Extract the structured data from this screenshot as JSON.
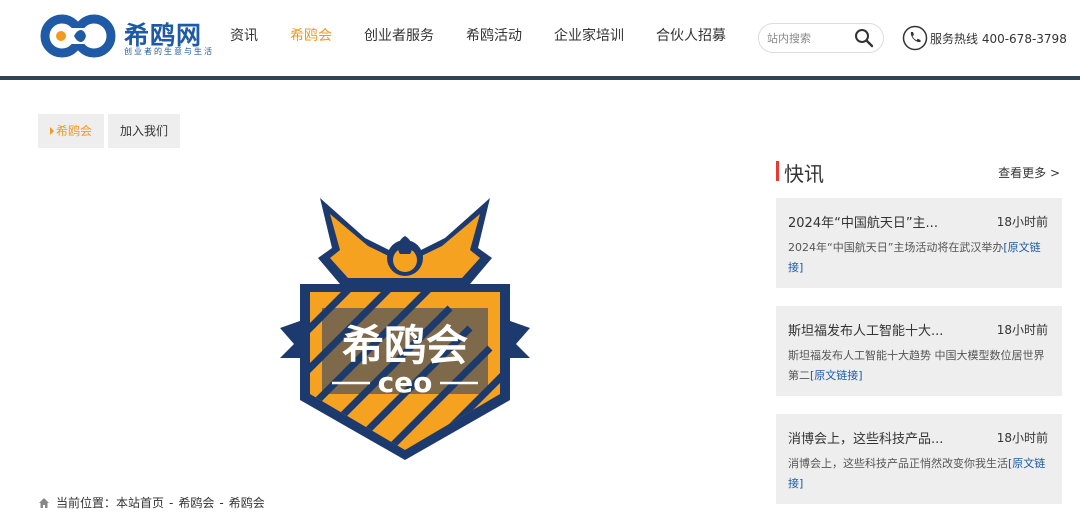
{
  "brand": {
    "name": "希鸥网",
    "tagline": "创业者的生意与生活",
    "color_primary": "#1f5aa6",
    "color_accent": "#f39a1e"
  },
  "nav": {
    "items": [
      {
        "label": "资讯",
        "active": false
      },
      {
        "label": "希鸥会",
        "active": true
      },
      {
        "label": "创业者服务",
        "active": false
      },
      {
        "label": "希鸥活动",
        "active": false
      },
      {
        "label": "企业家培训",
        "active": false
      },
      {
        "label": "合伙人招募",
        "active": false
      }
    ]
  },
  "search": {
    "placeholder": "站内搜索",
    "icon": "search-icon"
  },
  "hotline": {
    "text": "服务热线 400-678-3798",
    "icon": "phone-icon"
  },
  "subtabs": [
    {
      "label": "希鸥会",
      "active": true
    },
    {
      "label": "加入我们",
      "active": false
    }
  ],
  "emblem": {
    "title": "希鸥会",
    "subtitle": "ceo"
  },
  "breadcrumb": {
    "icon": "home-icon",
    "prefix": "当前位置：",
    "items": [
      "本站首页",
      "希鸥会",
      "希鸥会"
    ],
    "separator": "-"
  },
  "news": {
    "title": "快讯",
    "more": "查看更多 >",
    "items": [
      {
        "title": "2024年“中国航天日”主...",
        "time": "18小时前",
        "desc": "2024年“中国航天日”主场活动将在武汉举办",
        "source": "[原文链接]"
      },
      {
        "title": "斯坦福发布人工智能十大...",
        "time": "18小时前",
        "desc": "斯坦福发布人工智能十大趋势 中国大模型数位居世界第二",
        "source": "[原文链接]"
      },
      {
        "title": "消博会上，这些科技产品...",
        "time": "18小时前",
        "desc": "消博会上，这些科技产品正悄然改变你我生活",
        "source": "[原文链接]"
      }
    ]
  }
}
